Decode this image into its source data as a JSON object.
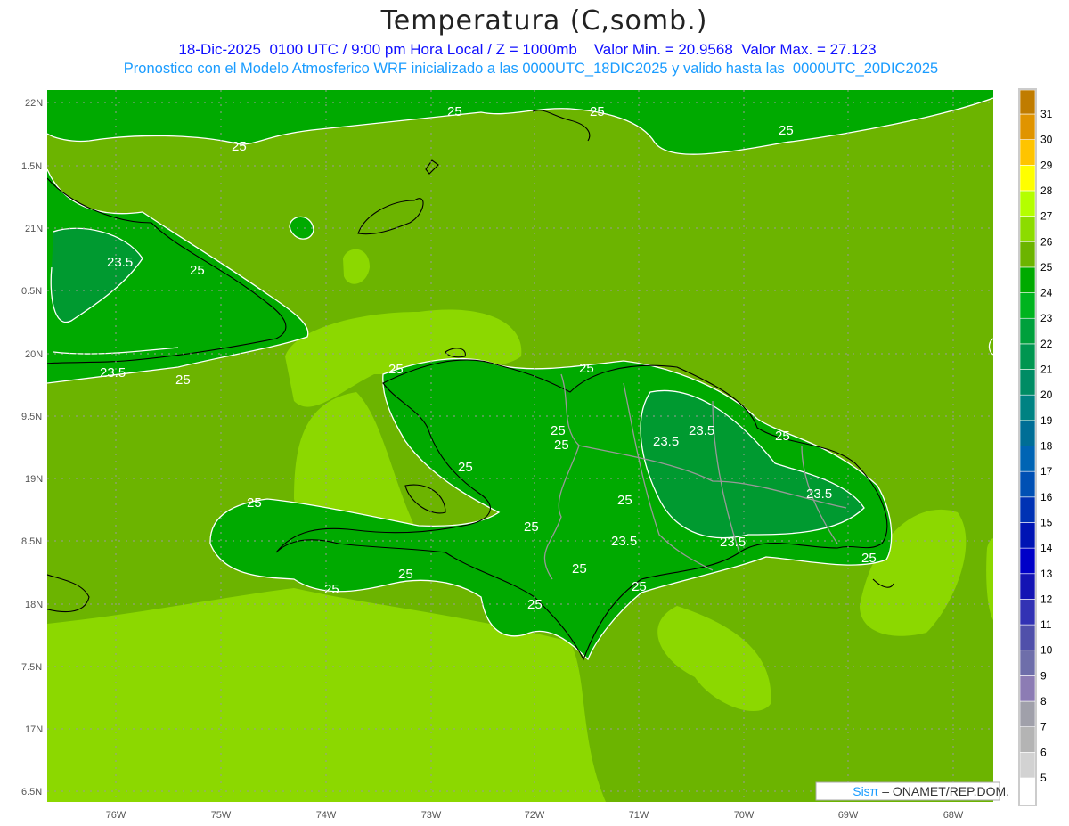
{
  "title": "Temperatura (C,somb.)",
  "subtitle": "18-Dic-2025  0100 UTC / 9:00 pm Hora Local / Z = 1000mb    Valor Min. = 20.9568  Valor Max. = 27.123",
  "subtitle2": "Pronostico con el Modelo Atmosferico WRF inicializado a las 0000UTC_18DIC2025 y valido hasta las  0000UTC_20DIC2025",
  "axes": {
    "lat_labels": [
      "22N",
      "1.5N",
      "21N",
      "0.5N",
      "20N",
      "9.5N",
      "19N",
      "8.5N",
      "18N",
      "7.5N",
      "17N",
      "6.5N"
    ],
    "lon_labels": [
      "76W",
      "75W",
      "74W",
      "73W",
      "72W",
      "71W",
      "70W",
      "69W",
      "68W"
    ]
  },
  "contour_labels": {
    "c25": "25",
    "c235": "23.5"
  },
  "colorbar": {
    "labels": [
      "31",
      "30",
      "29",
      "28",
      "27",
      "26",
      "25",
      "24",
      "23",
      "22",
      "21",
      "20",
      "19",
      "18",
      "17",
      "16",
      "15",
      "14",
      "13",
      "12",
      "11",
      "10",
      "9",
      "8",
      "7",
      "6",
      "5"
    ],
    "colors": [
      "#c07c00",
      "#e09400",
      "#ffc400",
      "#ffff00",
      "#b4ff00",
      "#8cdc00",
      "#6cb400",
      "#00aa00",
      "#00b41e",
      "#00a03c",
      "#009650",
      "#008c64",
      "#008282",
      "#006e96",
      "#0064b4",
      "#0050b4",
      "#0032b4",
      "#0014b4",
      "#0000c8",
      "#1414b4",
      "#3232b4",
      "#5050aa",
      "#6e6eaa",
      "#8c7cb4",
      "#a0a0aa",
      "#b4b4b4",
      "#d2d2d2",
      "#ffffff"
    ]
  },
  "credit": {
    "brand": "Sisπ",
    "text": " – ONAMET/REP.DOM."
  },
  "colors": {
    "band_25_26": "#6cb400",
    "band_26_27": "#8cd800",
    "band_24_25": "#00aa00",
    "band_23_24": "#00a030"
  }
}
